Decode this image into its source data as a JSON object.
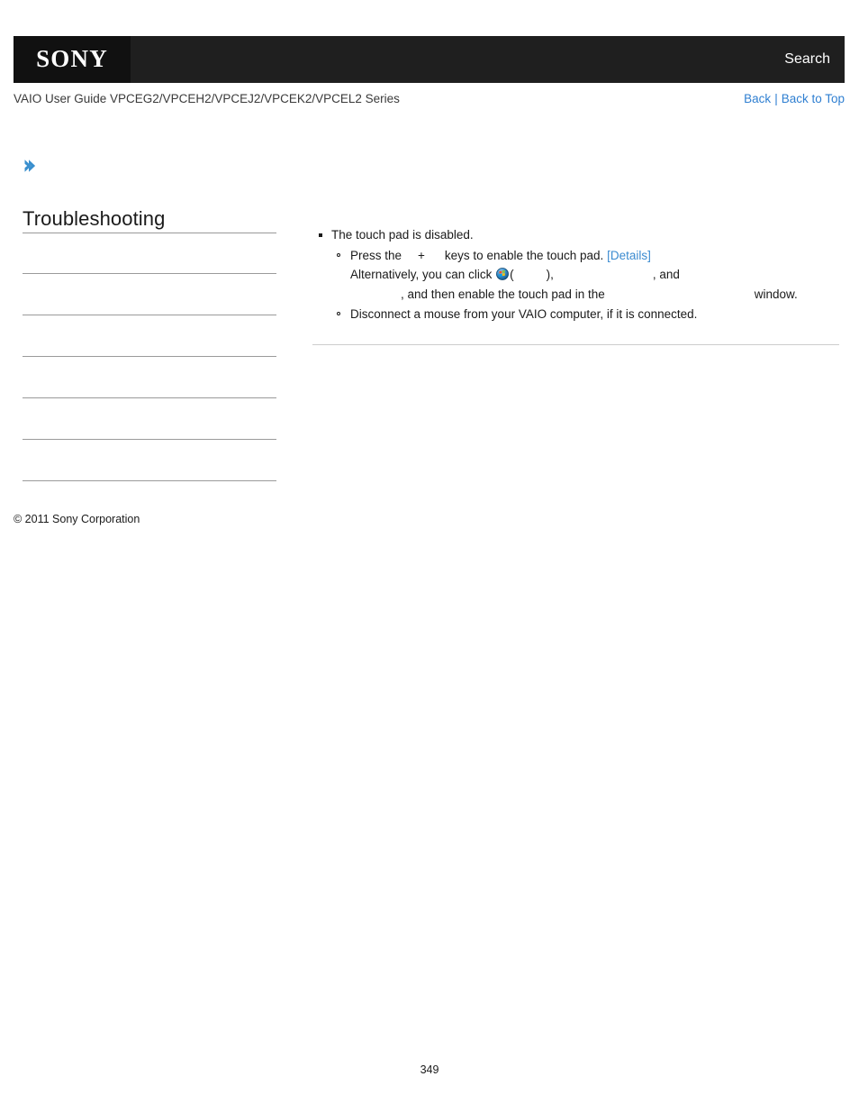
{
  "header": {
    "logo_text": "SONY",
    "search_label": "Search",
    "logo_icon": "sony-wordmark",
    "bg_color": "#1f1f1f",
    "logo_block_color": "#111111"
  },
  "subheader": {
    "guide_title": "VAIO User Guide VPCEG2/VPCEH2/VPCEJ2/VPCEK2/VPCEL2 Series",
    "back_label": "Back",
    "separator": "|",
    "back_to_top_label": "Back to Top",
    "link_color": "#2f7fd1"
  },
  "sidebar": {
    "expand_icon": "chevron-right-icon",
    "expand_icon_color": "#3a8fce",
    "title": "Troubleshooting",
    "items": [
      {
        "label": ""
      },
      {
        "label": ""
      },
      {
        "label": ""
      },
      {
        "label": ""
      },
      {
        "label": ""
      },
      {
        "label": ""
      }
    ],
    "copyright": "© 2011 Sony Corporation"
  },
  "content": {
    "items": [
      {
        "text": "The touch pad is disabled.",
        "subitems": [
          {
            "id": "enable-touch-pad",
            "prefix": "Press the",
            "plus": "+",
            "suffix": "keys to enable the touch pad.",
            "details_label": "[Details]",
            "alt_line_prefix": "Alternatively, you can click",
            "alt_paren_open": "(",
            "alt_paren_close": "),",
            "alt_comma": ",",
            "alt_and": "and",
            "alt_line2_comma": ",",
            "alt_line2_mid": "and then enable the touch pad in the",
            "alt_line2_end": "window.",
            "windows_orb_icon": "windows-start-orb-icon"
          },
          {
            "id": "disconnect-mouse",
            "text": "Disconnect a mouse from your VAIO computer, if it is connected."
          }
        ]
      }
    ],
    "details_link_color": "#3b8bd0"
  },
  "footer": {
    "page_number": "349"
  }
}
